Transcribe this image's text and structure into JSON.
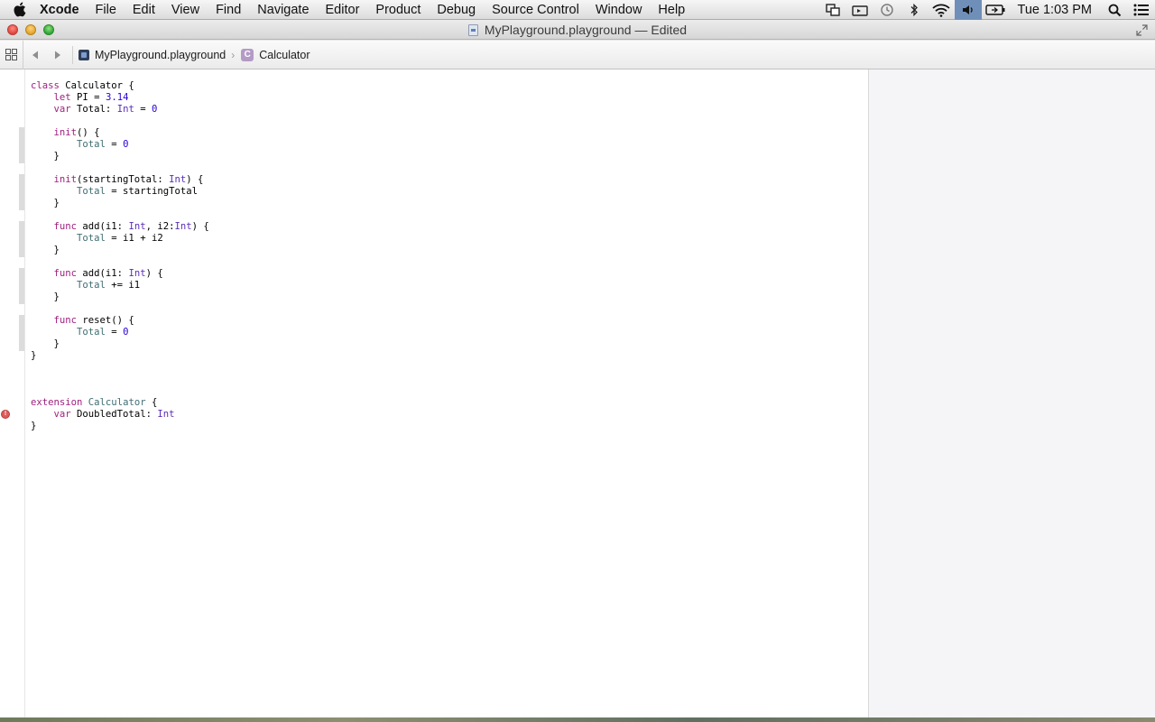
{
  "menubar": {
    "app_name": "Xcode",
    "items": [
      "File",
      "Edit",
      "View",
      "Find",
      "Navigate",
      "Editor",
      "Product",
      "Debug",
      "Source Control",
      "Window",
      "Help"
    ],
    "clock": "Tue 1:03 PM"
  },
  "window": {
    "title": "MyPlayground.playground — Edited"
  },
  "jumpbar": {
    "crumbs": [
      "MyPlayground.playground",
      "Calculator"
    ],
    "class_icon_letter": "C"
  },
  "editor": {
    "error_icon_glyph": "!"
  },
  "colors": {
    "keyword": "#a0207f",
    "type": "#5b2db8",
    "number": "#2a00d8",
    "variable": "#3f6e74"
  }
}
